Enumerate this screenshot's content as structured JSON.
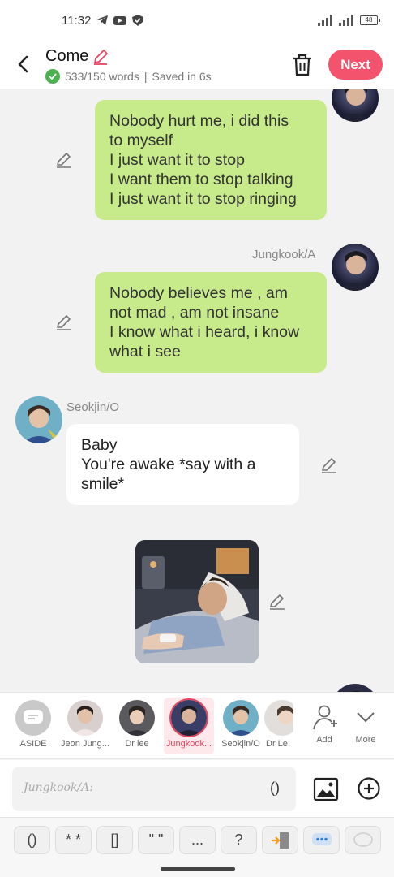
{
  "status_bar": {
    "time": "11:32",
    "battery": "48"
  },
  "header": {
    "title": "Come",
    "word_count": "533/150 words",
    "separator": "|",
    "saved": "Saved in 6s",
    "next_label": "Next"
  },
  "messages": [
    {
      "speaker": "",
      "side": "right",
      "lines": [
        "Nobody hurt me, i did this",
        "to myself",
        "I just want it to stop",
        "I want them to stop talking",
        "I just want it to stop ringing"
      ]
    },
    {
      "speaker": "Jungkook/A",
      "side": "right",
      "lines": [
        "Nobody believes me , am",
        "not mad , am not insane",
        "I know what i heard, i know",
        "what i see"
      ]
    },
    {
      "speaker": "Seokjin/O",
      "side": "left",
      "lines": [
        "Baby",
        "You're awake *say with a",
        "smile*"
      ]
    },
    {
      "speaker": "",
      "side": "center",
      "type": "image",
      "alt": "hospital-bed-image"
    }
  ],
  "characters": [
    {
      "name": "ASIDE"
    },
    {
      "name": "Jeon Jung..."
    },
    {
      "name": "Dr lee"
    },
    {
      "name": "Jungkook..."
    },
    {
      "name": "Seokjin/O"
    },
    {
      "name": "Dr Le"
    },
    {
      "name": "Add"
    },
    {
      "name": "More"
    }
  ],
  "input": {
    "placeholder": "Jungkook/A:",
    "paren": "()"
  },
  "shortcuts": [
    "()",
    "* *",
    "[]",
    "\" \"",
    "...",
    "?"
  ],
  "colors": {
    "accent": "#f4536d",
    "bubble_green": "#c7ea8a",
    "selected": "#e8465f"
  }
}
